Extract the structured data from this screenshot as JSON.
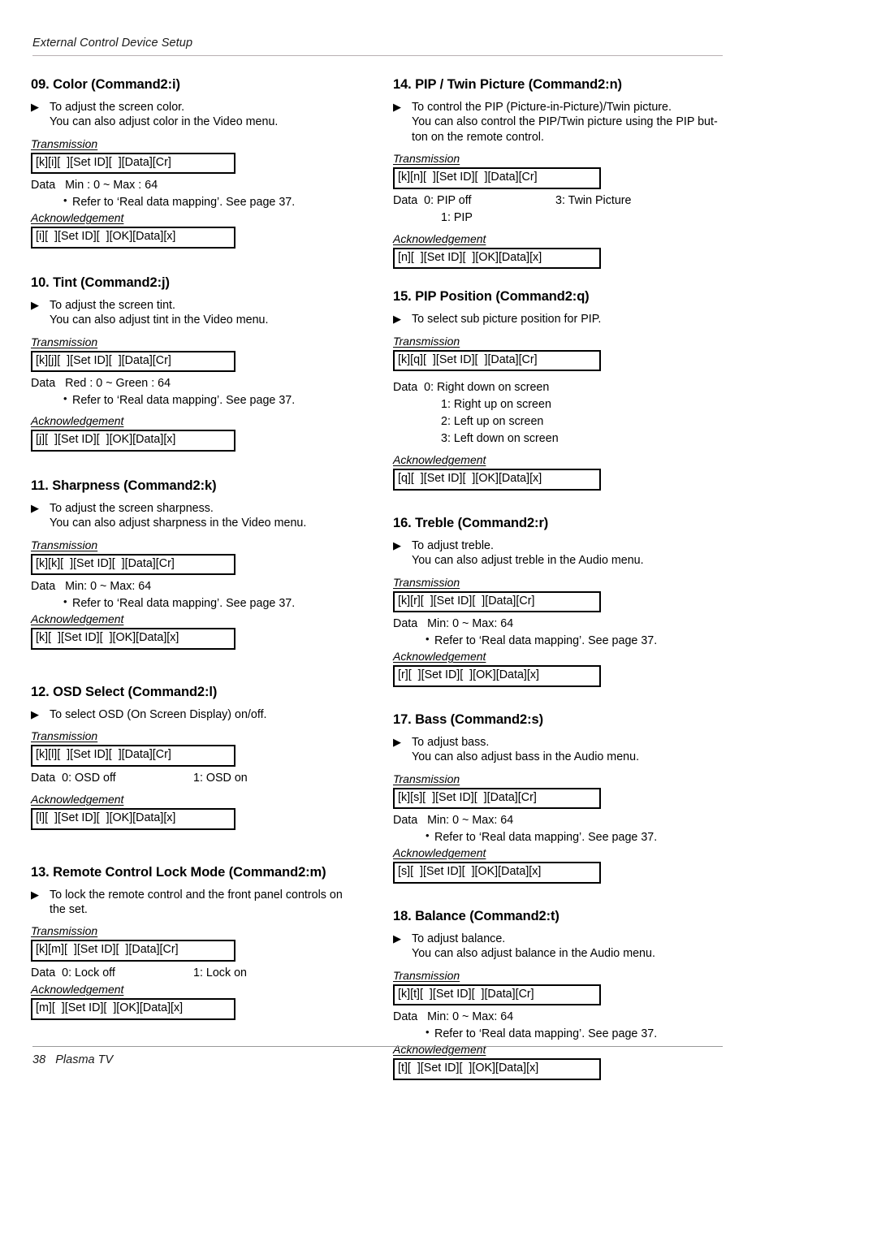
{
  "header": {
    "running_head": "External Control Device Setup"
  },
  "footer": {
    "page_number": "38",
    "product": "Plasma TV"
  },
  "labels": {
    "transmission": "Transmission",
    "acknowledgement": "Acknowledgement",
    "data": "Data",
    "arrow_bullet": "▶",
    "dot_bullet": "•",
    "ref_note": "Refer to ‘Real data mapping’. See page 37."
  },
  "left_column": [
    {
      "title": "09. Color (Command2:i)",
      "desc_line1": "To adjust the screen color.",
      "desc_line2": "You can also adjust color in the Video menu.",
      "transmission_code": "[k][i][  ][Set ID][  ][Data][Cr]",
      "data_main": "Min : 0 ~ Max : 64",
      "data_col2": "",
      "data_sub": "",
      "has_ref": true,
      "ack_code": "[i][  ][Set ID][  ][OK][Data][x]"
    },
    {
      "title": "10. Tint (Command2:j)",
      "desc_line1": "To adjust the screen tint.",
      "desc_line2": "You can also adjust tint in the Video menu.",
      "transmission_code": "[k][j][  ][Set ID][  ][Data][Cr]",
      "data_main": "Red : 0 ~ Green : 64",
      "data_col2": "",
      "data_sub": "",
      "has_ref": true,
      "ack_code": "[j][  ][Set ID][  ][OK][Data][x]"
    },
    {
      "title": "11. Sharpness (Command2:k)",
      "desc_line1": "To adjust the screen sharpness.",
      "desc_line2": "You can also adjust sharpness in the Video menu.",
      "transmission_code": "[k][k][  ][Set ID][  ][Data][Cr]",
      "data_main": "Min: 0 ~ Max: 64",
      "data_col2": "",
      "data_sub": "",
      "has_ref": true,
      "ack_code": "[k][  ][Set ID][  ][OK][Data][x]"
    },
    {
      "title": "12. OSD Select (Command2:l)",
      "desc_line1": "To select OSD (On Screen Display) on/off.",
      "desc_line2": "",
      "transmission_code": "[k][l][  ][Set ID][  ][Data][Cr]",
      "data_main": "0: OSD off",
      "data_col2": "1: OSD on",
      "data_sub": "",
      "has_ref": false,
      "ack_code": "[l][  ][Set ID][  ][OK][Data][x]"
    },
    {
      "title": "13. Remote Control Lock Mode (Command2:m)",
      "desc_line1": "To lock the remote control and the front panel controls on",
      "desc_line2": "the set.",
      "transmission_code": "[k][m][  ][Set ID][  ][Data][Cr]",
      "data_main": "0: Lock off",
      "data_col2": "1: Lock on",
      "data_sub": "",
      "has_ref": false,
      "ack_code": "[m][  ][Set ID][  ][OK][Data][x]"
    }
  ],
  "right_column": [
    {
      "title": "14. PIP / Twin Picture (Command2:n)",
      "desc_line1": "To control the PIP (Picture-in-Picture)/Twin picture.",
      "desc_line2": "You can also control the PIP/Twin picture using the PIP but-",
      "desc_line3": "ton on the remote control.",
      "transmission_code": "[k][n][  ][Set ID][  ][Data][Cr]",
      "data_main": "0: PIP off",
      "data_col2": "3: Twin Picture",
      "data_sub": "1: PIP",
      "has_ref": false,
      "ack_code": "[n][  ][Set ID][  ][OK][Data][x]"
    },
    {
      "title": "15. PIP Position (Command2:q)",
      "desc_line1": "To select sub picture position for PIP.",
      "desc_line2": "",
      "transmission_code": "[k][q][  ][Set ID][  ][Data][Cr]",
      "data_main": "0: Right down on screen",
      "data_col2": "",
      "data_sub": "1: Right up on screen",
      "data_sub2": "2: Left up on screen",
      "data_sub3": "3: Left down on screen",
      "has_ref": false,
      "ack_code": "[q][  ][Set ID][  ][OK][Data][x]"
    },
    {
      "title": "16. Treble (Command2:r)",
      "desc_line1": "To adjust treble.",
      "desc_line2": "You can also adjust treble in the Audio menu.",
      "transmission_code": "[k][r][  ][Set ID][  ][Data][Cr]",
      "data_main": "Min: 0 ~ Max: 64",
      "data_col2": "",
      "data_sub": "",
      "has_ref": true,
      "ack_code": "[r][  ][Set ID][  ][OK][Data][x]"
    },
    {
      "title": "17. Bass (Command2:s)",
      "desc_line1": "To adjust bass.",
      "desc_line2": "You can also adjust bass in the Audio menu.",
      "transmission_code": "[k][s][  ][Set ID][  ][Data][Cr]",
      "data_main": "Min: 0 ~ Max: 64",
      "data_col2": "",
      "data_sub": "",
      "has_ref": true,
      "ack_code": "[s][  ][Set ID][  ][OK][Data][x]"
    },
    {
      "title": "18. Balance (Command2:t)",
      "desc_line1": "To adjust balance.",
      "desc_line2": "You can also adjust balance in the Audio menu.",
      "transmission_code": "[k][t][  ][Set ID][  ][Data][Cr]",
      "data_main": "Min: 0 ~ Max: 64",
      "data_col2": "",
      "data_sub": "",
      "has_ref": true,
      "ack_code": "[t][  ][Set ID][  ][OK][Data][x]"
    }
  ]
}
